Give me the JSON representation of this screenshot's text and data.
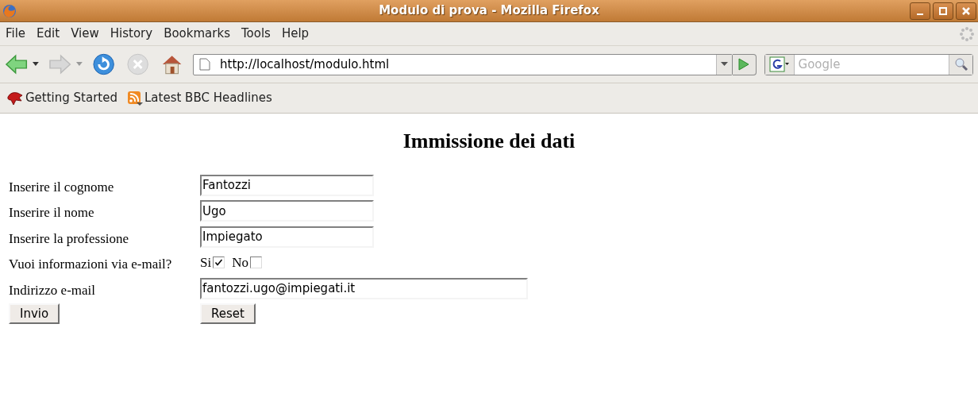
{
  "window": {
    "title": "Modulo di prova - Mozilla Firefox"
  },
  "menu": [
    "File",
    "Edit",
    "View",
    "History",
    "Bookmarks",
    "Tools",
    "Help"
  ],
  "address_bar": {
    "value": "http://localhost/modulo.html"
  },
  "search": {
    "placeholder": "Google"
  },
  "bookmarks": [
    {
      "label": "Getting Started",
      "kind": "page"
    },
    {
      "label": "Latest BBC Headlines",
      "kind": "feed"
    }
  ],
  "page": {
    "heading": "Immissione dei dati",
    "rows": [
      {
        "kind": "text",
        "label": "Inserire il cognome",
        "value": "Fantozzi",
        "wide": false
      },
      {
        "kind": "text",
        "label": "Inserire il nome",
        "value": "Ugo",
        "wide": false
      },
      {
        "kind": "text",
        "label": "Inserire la professione",
        "value": "Impiegato",
        "wide": false
      },
      {
        "kind": "checks",
        "label": "Vuoi informazioni via e-mail?",
        "options": [
          {
            "label": "Si",
            "checked": true
          },
          {
            "label": "No",
            "checked": false
          }
        ]
      },
      {
        "kind": "text",
        "label": "Indirizzo e-mail",
        "value": "fantozzi.ugo@impiegati.it",
        "wide": true
      }
    ],
    "buttons": [
      "Invio",
      "Reset"
    ]
  }
}
